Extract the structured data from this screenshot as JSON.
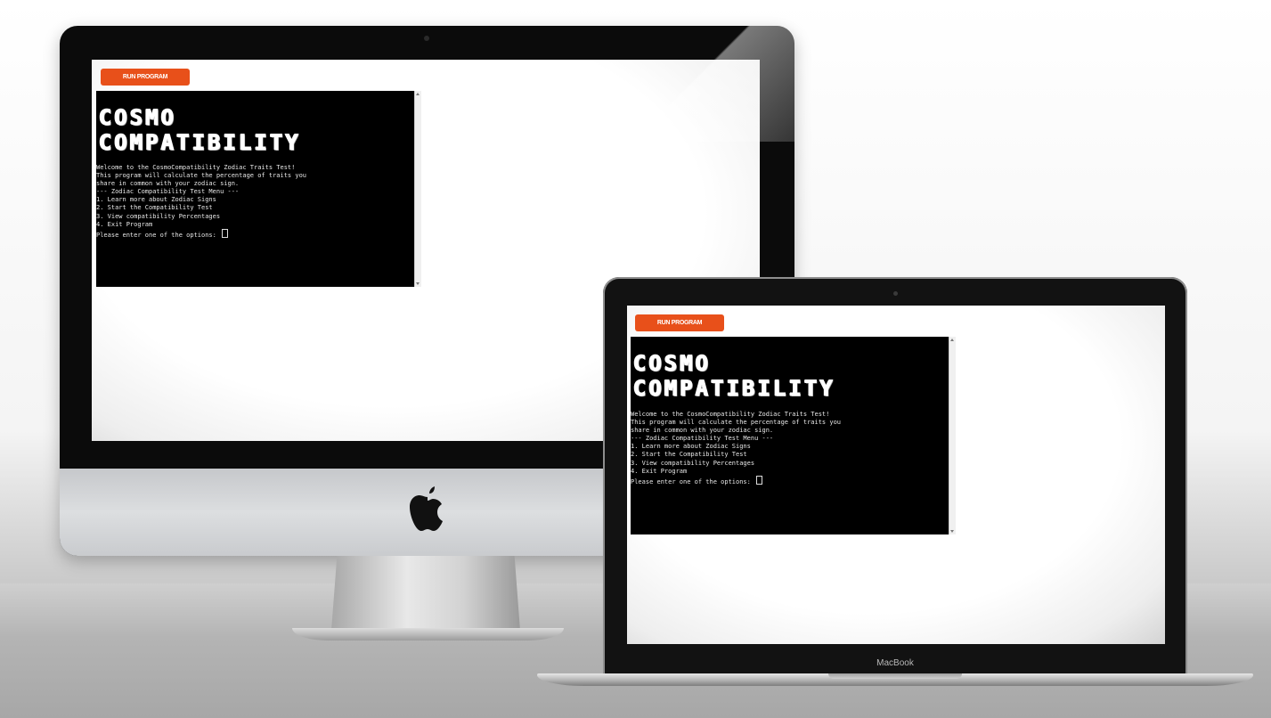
{
  "app": {
    "run_button_label": "RUN PROGRAM",
    "banner": [
      "COSMO",
      "COMPATIBILITY"
    ],
    "terminal_lines": [
      "Welcome to the CosmoCompatibility Zodiac Traits Test!",
      "This program will calculate the percentage of traits you",
      "share in common with your zodiac sign.",
      "",
      "--- Zodiac Compatibility Test Menu ---",
      "1. Learn more about Zodiac Signs",
      "2. Start the Compatibility Test",
      "3. View compatibility Percentages",
      "4. Exit Program",
      ""
    ],
    "prompt": "Please enter one of the options: "
  },
  "devices": {
    "laptop_label": "MacBook"
  },
  "colors": {
    "button": "#e8501a",
    "terminal_bg": "#000000",
    "terminal_text": "#e6e6e6"
  },
  "icons": {
    "desktop_logo": "apple-logo-icon"
  }
}
